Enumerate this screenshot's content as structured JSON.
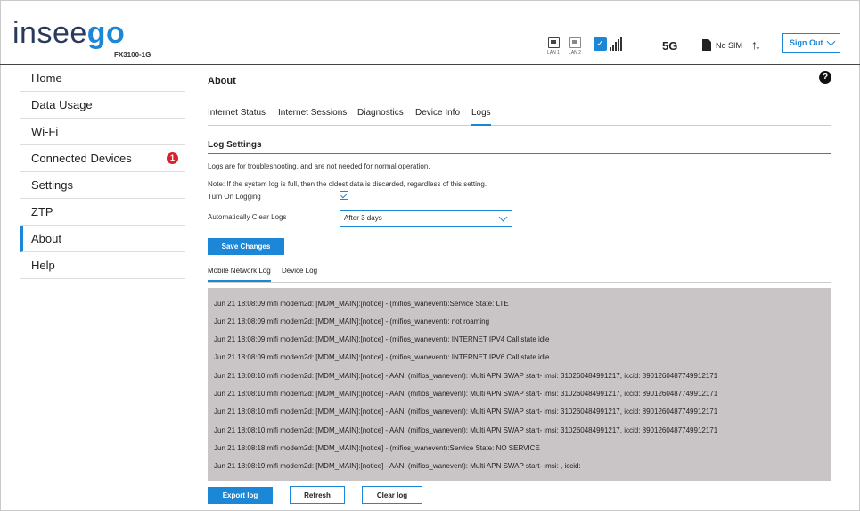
{
  "header": {
    "logo_main": "insee",
    "logo_accent": "go",
    "model": "FX3100-1G",
    "lan1_label": "LAN 1",
    "lan2_label": "LAN 2",
    "wifi_check": "✓",
    "network_type": "5G",
    "sim_status": "No SIM",
    "data_arrows": "↑↓",
    "signout_label": "Sign Out",
    "accent_color": "#1b87d6"
  },
  "sidebar": {
    "items": [
      {
        "label": "Home"
      },
      {
        "label": "Data Usage"
      },
      {
        "label": "Wi-Fi"
      },
      {
        "label": "Connected Devices",
        "badge": "1"
      },
      {
        "label": "Settings"
      },
      {
        "label": "ZTP"
      },
      {
        "label": "About"
      },
      {
        "label": "Help"
      }
    ]
  },
  "main": {
    "title": "About",
    "help_glyph": "?",
    "tabs": [
      {
        "label": "Internet Status"
      },
      {
        "label": "Internet Sessions"
      },
      {
        "label": "Diagnostics"
      },
      {
        "label": "Device Info"
      },
      {
        "label": "Logs"
      }
    ],
    "section_title": "Log Settings",
    "note1": "Logs are for troubleshooting, and are not needed for normal operation.",
    "note2": "Note: If the system log is full, then the oldest data is discarded, regardless of this setting.",
    "turn_on_logging_label": "Turn On Logging",
    "auto_clear_label": "Automatically Clear Logs",
    "auto_clear_value": "After 3 days",
    "save_button": "Save Changes",
    "subtabs": [
      {
        "label": "Mobile Network Log"
      },
      {
        "label": "Device Log"
      }
    ],
    "log_lines": [
      "Jun 21 18:08:09 mifi modem2d: [MDM_MAIN]:[notice] - (mifios_wanevent):Service State: LTE",
      "Jun 21 18:08:09 mifi modem2d: [MDM_MAIN]:[notice] - (mifios_wanevent): not roaming",
      "Jun 21 18:08:09 mifi modem2d: [MDM_MAIN]:[notice] - (mifios_wanevent): INTERNET IPV4 Call state idle",
      "Jun 21 18:08:09 mifi modem2d: [MDM_MAIN]:[notice] - (mifios_wanevent): INTERNET IPV6 Call state idle",
      "Jun 21 18:08:10 mifi modem2d: [MDM_MAIN]:[notice] - AAN: (mifios_wanevent): Multi APN SWAP start- imsi: 310260484991217, iccid: 8901260487749912171",
      "Jun 21 18:08:10 mifi modem2d: [MDM_MAIN]:[notice] - AAN: (mifios_wanevent): Multi APN SWAP start- imsi: 310260484991217, iccid: 8901260487749912171",
      "Jun 21 18:08:10 mifi modem2d: [MDM_MAIN]:[notice] - AAN: (mifios_wanevent): Multi APN SWAP start- imsi: 310260484991217, iccid: 8901260487749912171",
      "Jun 21 18:08:10 mifi modem2d: [MDM_MAIN]:[notice] - AAN: (mifios_wanevent): Multi APN SWAP start- imsi: 310260484991217, iccid: 8901260487749912171",
      "Jun 21 18:08:18 mifi modem2d: [MDM_MAIN]:[notice] - (mifios_wanevent):Service State: NO SERVICE",
      "Jun 21 18:08:19 mifi modem2d: [MDM_MAIN]:[notice] - AAN: (mifios_wanevent): Multi APN SWAP start- imsi: , iccid:"
    ],
    "export_button": "Export log",
    "refresh_button": "Refresh",
    "clear_button": "Clear log"
  }
}
